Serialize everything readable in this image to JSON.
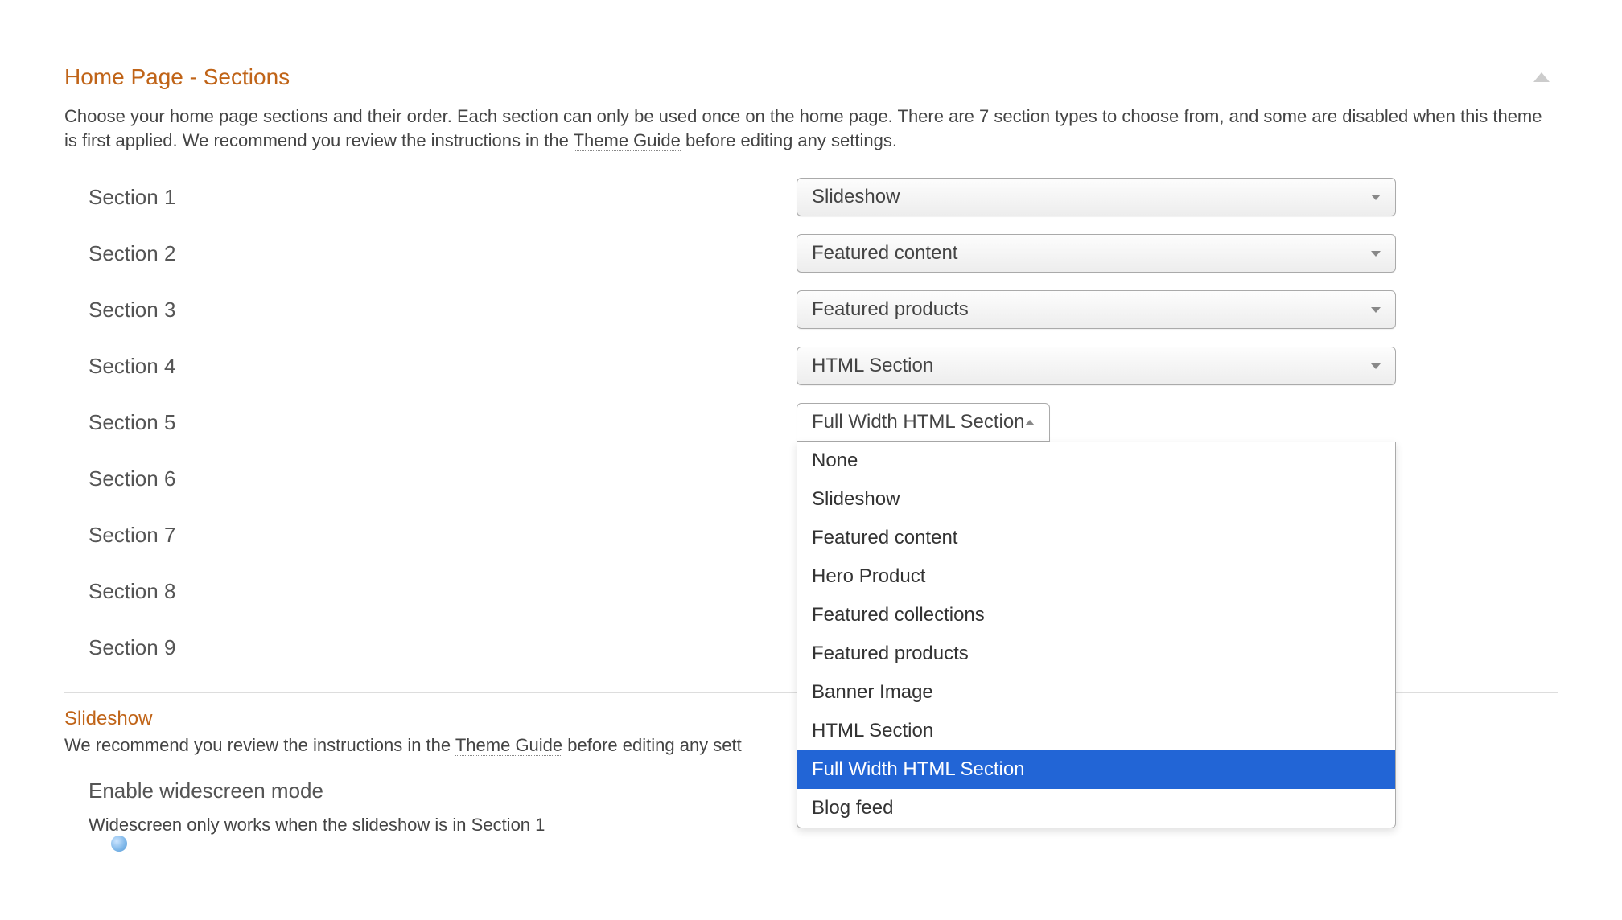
{
  "header": {
    "title": "Home Page - Sections"
  },
  "description": {
    "text_before_link": "Choose your home page sections and their order. Each section can only be used once on the home page. There are 7 section types to choose from, and some are disabled when this theme is first applied. We recommend you review the instructions in the ",
    "link_text": "Theme Guide",
    "text_after_link": " before editing any settings."
  },
  "sections": [
    {
      "label": "Section 1",
      "value": "Slideshow"
    },
    {
      "label": "Section 2",
      "value": "Featured content"
    },
    {
      "label": "Section 3",
      "value": "Featured products"
    },
    {
      "label": "Section 4",
      "value": "HTML Section"
    },
    {
      "label": "Section 5",
      "value": "Full Width HTML Section"
    },
    {
      "label": "Section 6",
      "value": ""
    },
    {
      "label": "Section 7",
      "value": ""
    },
    {
      "label": "Section 8",
      "value": ""
    },
    {
      "label": "Section 9",
      "value": ""
    }
  ],
  "dropdown_options": [
    "None",
    "Slideshow",
    "Featured content",
    "Hero Product",
    "Featured collections",
    "Featured products",
    "Banner Image",
    "HTML Section",
    "Full Width HTML Section",
    "Blog feed"
  ],
  "open_dropdown_index": 4,
  "selected_option": "Full Width HTML Section",
  "slideshow": {
    "title": "Slideshow",
    "desc_before_link": "We recommend you review the instructions in the ",
    "link_text": "Theme Guide",
    "desc_after_link": " before editing any sett",
    "enable_label": "Enable widescreen mode",
    "enable_note": "Widescreen only works when the slideshow is in Section 1"
  }
}
